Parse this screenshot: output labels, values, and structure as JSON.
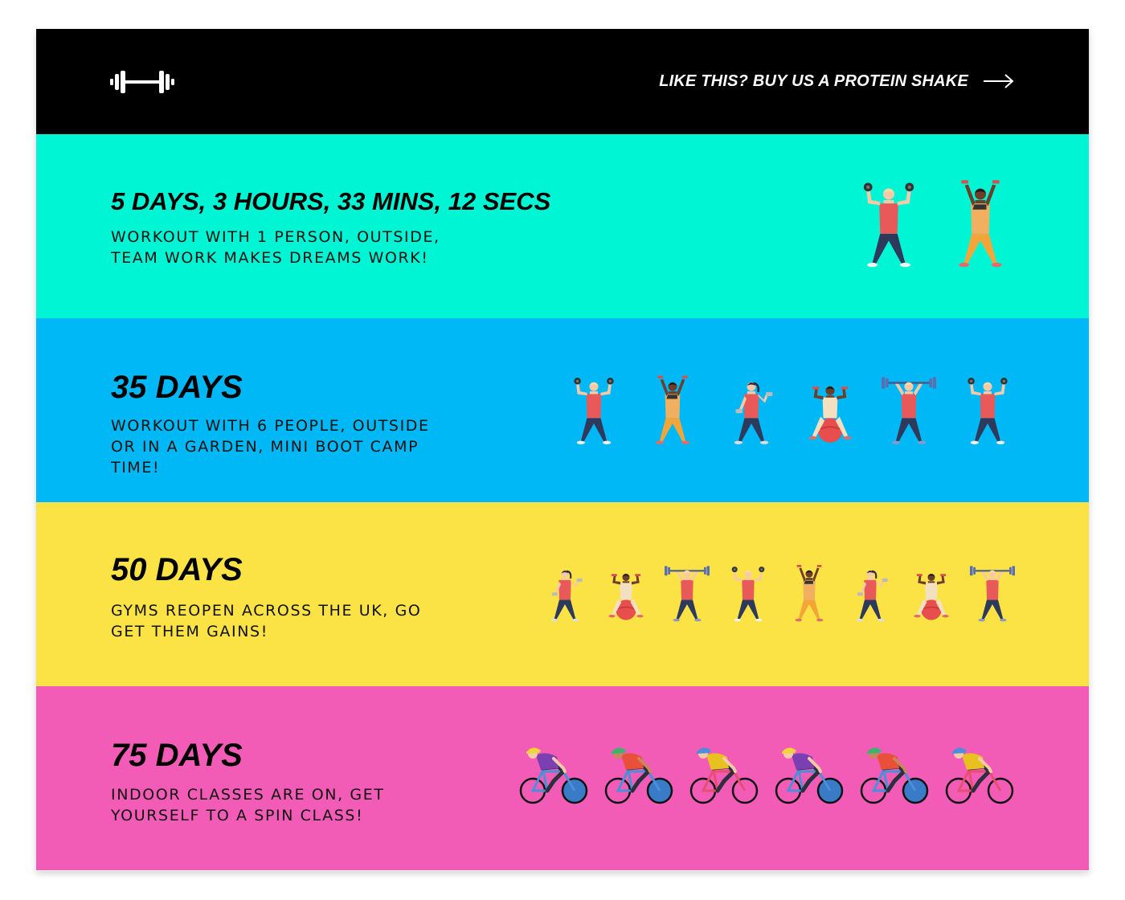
{
  "header": {
    "logo_icon": "dumbbell-icon",
    "cta_label": "LIKE THIS? BUY US A PROTEIN SHAKE",
    "cta_icon": "arrow-right-icon"
  },
  "colors": {
    "header_bg": "#000000",
    "band_1": "#00F5D4",
    "band_2": "#00B8F5",
    "band_3": "#FBE345",
    "band_4": "#F25CB6"
  },
  "sections": [
    {
      "title": "5 DAYS, 3 HOURS, 33 MINS, 12 SECS",
      "desc_lines": [
        "WORKOUT WITH 1 PERSON, OUTSIDE,",
        "TEAM WORK MAKES DREAMS WORK!"
      ],
      "figures": [
        "dumbbell-press-man",
        "arms-up-woman"
      ]
    },
    {
      "title": "35 DAYS",
      "desc_lines": [
        "WORKOUT WITH 6 PEOPLE, OUTSIDE",
        "OR IN A GARDEN, MINI BOOT CAMP",
        "TIME!"
      ],
      "figures": [
        "dumbbell-press-man",
        "arms-up-woman",
        "dumbbell-curl-woman",
        "exercise-ball-woman",
        "barbell-man",
        "dumbbell-press-man"
      ]
    },
    {
      "title": "50 DAYS",
      "desc_lines": [
        "GYMS REOPEN ACROSS THE UK, GO",
        "GET THEM GAINS!"
      ],
      "figures": [
        "dumbbell-curl-woman",
        "exercise-ball-woman",
        "barbell-man",
        "dumbbell-press-man",
        "arms-up-woman",
        "dumbbell-curl-woman",
        "exercise-ball-woman",
        "barbell-man"
      ]
    },
    {
      "title": "75 DAYS",
      "desc_lines": [
        "INDOOR CLASSES ARE ON, GET",
        "YOURSELF TO A SPIN CLASS!"
      ],
      "figures": [
        "cyclist-purple",
        "cyclist-red",
        "cyclist-yellow",
        "cyclist-purple",
        "cyclist-red",
        "cyclist-yellow"
      ]
    }
  ]
}
